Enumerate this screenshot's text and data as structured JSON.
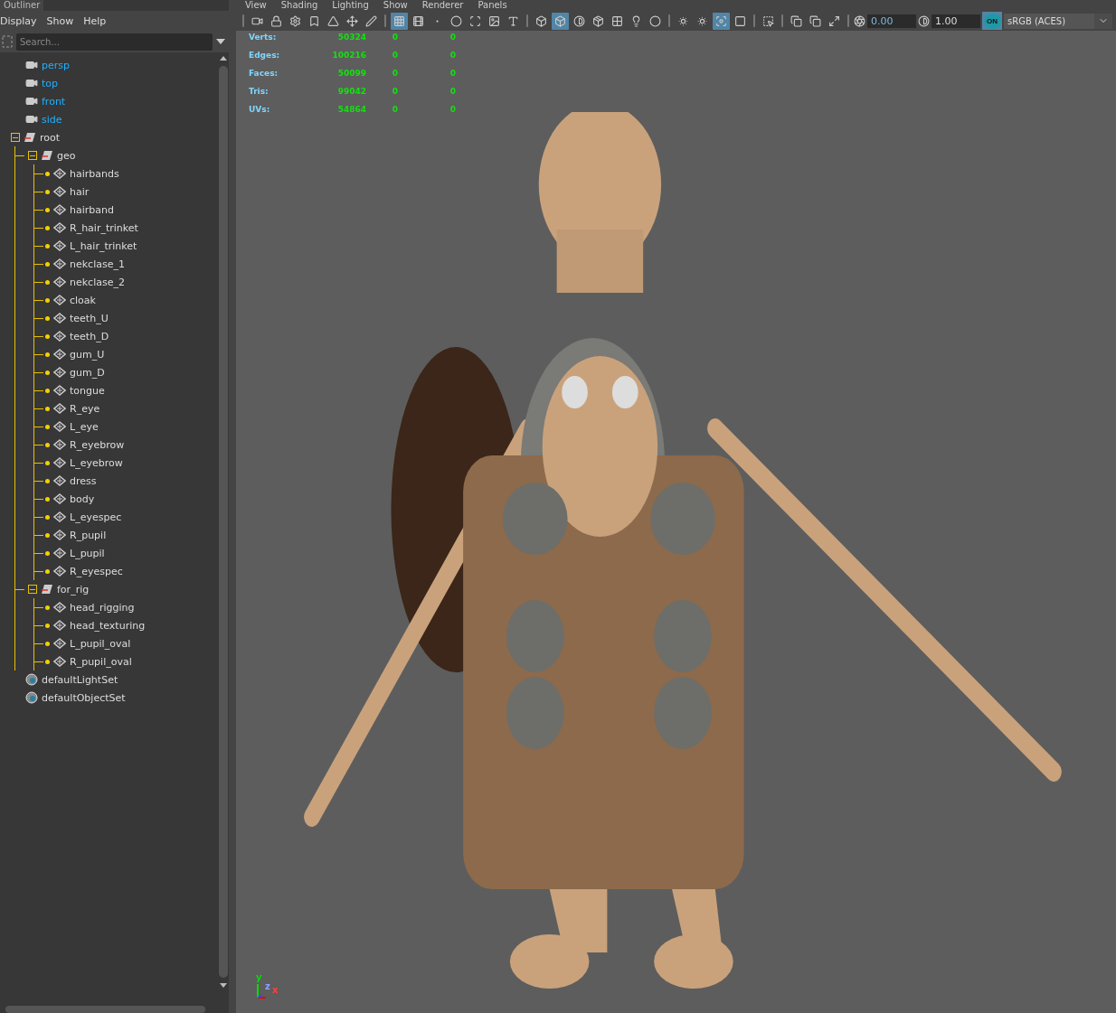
{
  "outliner": {
    "title": "Outliner",
    "menu": [
      "Display",
      "Show",
      "Help"
    ],
    "search": {
      "placeholder": "Search..."
    },
    "tree": [
      {
        "kind": "camera",
        "label": "persp"
      },
      {
        "kind": "camera",
        "label": "top"
      },
      {
        "kind": "camera",
        "label": "front"
      },
      {
        "kind": "camera",
        "label": "side"
      },
      {
        "kind": "group",
        "label": "root",
        "expanded": true,
        "children": [
          {
            "kind": "group",
            "label": "geo",
            "expanded": true,
            "children": [
              {
                "kind": "mesh",
                "label": "hairbands"
              },
              {
                "kind": "mesh",
                "label": "hair"
              },
              {
                "kind": "mesh",
                "label": "hairband"
              },
              {
                "kind": "mesh",
                "label": "R_hair_trinket"
              },
              {
                "kind": "mesh",
                "label": "L_hair_trinket"
              },
              {
                "kind": "mesh",
                "label": "nekclase_1"
              },
              {
                "kind": "mesh",
                "label": "nekclase_2"
              },
              {
                "kind": "mesh",
                "label": "cloak"
              },
              {
                "kind": "mesh",
                "label": "teeth_U"
              },
              {
                "kind": "mesh",
                "label": "teeth_D"
              },
              {
                "kind": "mesh",
                "label": "gum_U"
              },
              {
                "kind": "mesh",
                "label": "gum_D"
              },
              {
                "kind": "mesh",
                "label": "tongue"
              },
              {
                "kind": "mesh",
                "label": "R_eye"
              },
              {
                "kind": "mesh",
                "label": "L_eye"
              },
              {
                "kind": "mesh",
                "label": "R_eyebrow"
              },
              {
                "kind": "mesh",
                "label": "L_eyebrow"
              },
              {
                "kind": "mesh",
                "label": "dress"
              },
              {
                "kind": "mesh",
                "label": "body"
              },
              {
                "kind": "mesh",
                "label": "L_eyespec"
              },
              {
                "kind": "mesh",
                "label": "R_pupil"
              },
              {
                "kind": "mesh",
                "label": "L_pupil"
              },
              {
                "kind": "mesh",
                "label": "R_eyespec"
              }
            ]
          },
          {
            "kind": "group",
            "label": "for_rig",
            "expanded": true,
            "children": [
              {
                "kind": "mesh",
                "label": "head_rigging"
              },
              {
                "kind": "mesh",
                "label": "head_texturing"
              },
              {
                "kind": "mesh",
                "label": "L_pupil_oval"
              },
              {
                "kind": "mesh",
                "label": "R_pupil_oval"
              }
            ]
          }
        ]
      },
      {
        "kind": "set",
        "label": "defaultLightSet"
      },
      {
        "kind": "set",
        "label": "defaultObjectSet"
      }
    ]
  },
  "viewport": {
    "menu": [
      "View",
      "Shading",
      "Lighting",
      "Show",
      "Renderer",
      "Panels"
    ],
    "toolbar": [
      [
        {
          "kind": "camera",
          "selected": false
        },
        {
          "kind": "lock",
          "selected": false
        },
        {
          "kind": "gear",
          "selected": false
        },
        {
          "kind": "bookmark",
          "selected": false
        },
        {
          "kind": "triangle",
          "selected": false
        },
        {
          "kind": "move",
          "selected": false
        },
        {
          "kind": "pen",
          "selected": false
        }
      ],
      [
        {
          "kind": "grid",
          "selected": true
        },
        {
          "kind": "film",
          "selected": false
        },
        {
          "kind": "dot",
          "selected": false
        },
        {
          "kind": "circle",
          "selected": false
        },
        {
          "kind": "scan",
          "selected": false
        },
        {
          "kind": "image",
          "selected": false
        },
        {
          "kind": "text",
          "selected": false
        }
      ],
      [
        {
          "kind": "box",
          "selected": false
        },
        {
          "kind": "box",
          "selected": true
        },
        {
          "kind": "contrast",
          "selected": false
        },
        {
          "kind": "package",
          "selected": false
        },
        {
          "kind": "checker",
          "selected": false
        },
        {
          "kind": "bulb",
          "selected": false
        },
        {
          "kind": "circle",
          "selected": false
        }
      ],
      [
        {
          "kind": "sphere",
          "selected": false
        },
        {
          "kind": "sphere",
          "selected": false
        },
        {
          "kind": "focus",
          "selected": true
        },
        {
          "kind": "square",
          "selected": false
        }
      ],
      [
        {
          "kind": "select",
          "selected": false
        }
      ],
      [
        {
          "kind": "copy",
          "selected": false
        },
        {
          "kind": "copy",
          "selected": false
        },
        {
          "kind": "maximize",
          "selected": false
        }
      ]
    ],
    "exposure": "0.00",
    "gamma": "1.00",
    "color_management": {
      "label": "ON",
      "on": true
    },
    "view_transform": "sRGB (ACES)",
    "stats": [
      {
        "label": "Verts:",
        "values": [
          "50324",
          "0",
          "0"
        ]
      },
      {
        "label": "Edges:",
        "values": [
          "100216",
          "0",
          "0"
        ]
      },
      {
        "label": "Faces:",
        "values": [
          "50099",
          "0",
          "0"
        ]
      },
      {
        "label": "Tris:",
        "values": [
          "99042",
          "0",
          "0"
        ]
      },
      {
        "label": "UVs:",
        "values": [
          "54864",
          "0",
          "0"
        ]
      }
    ],
    "axes": [
      "y",
      "z",
      "x"
    ]
  }
}
